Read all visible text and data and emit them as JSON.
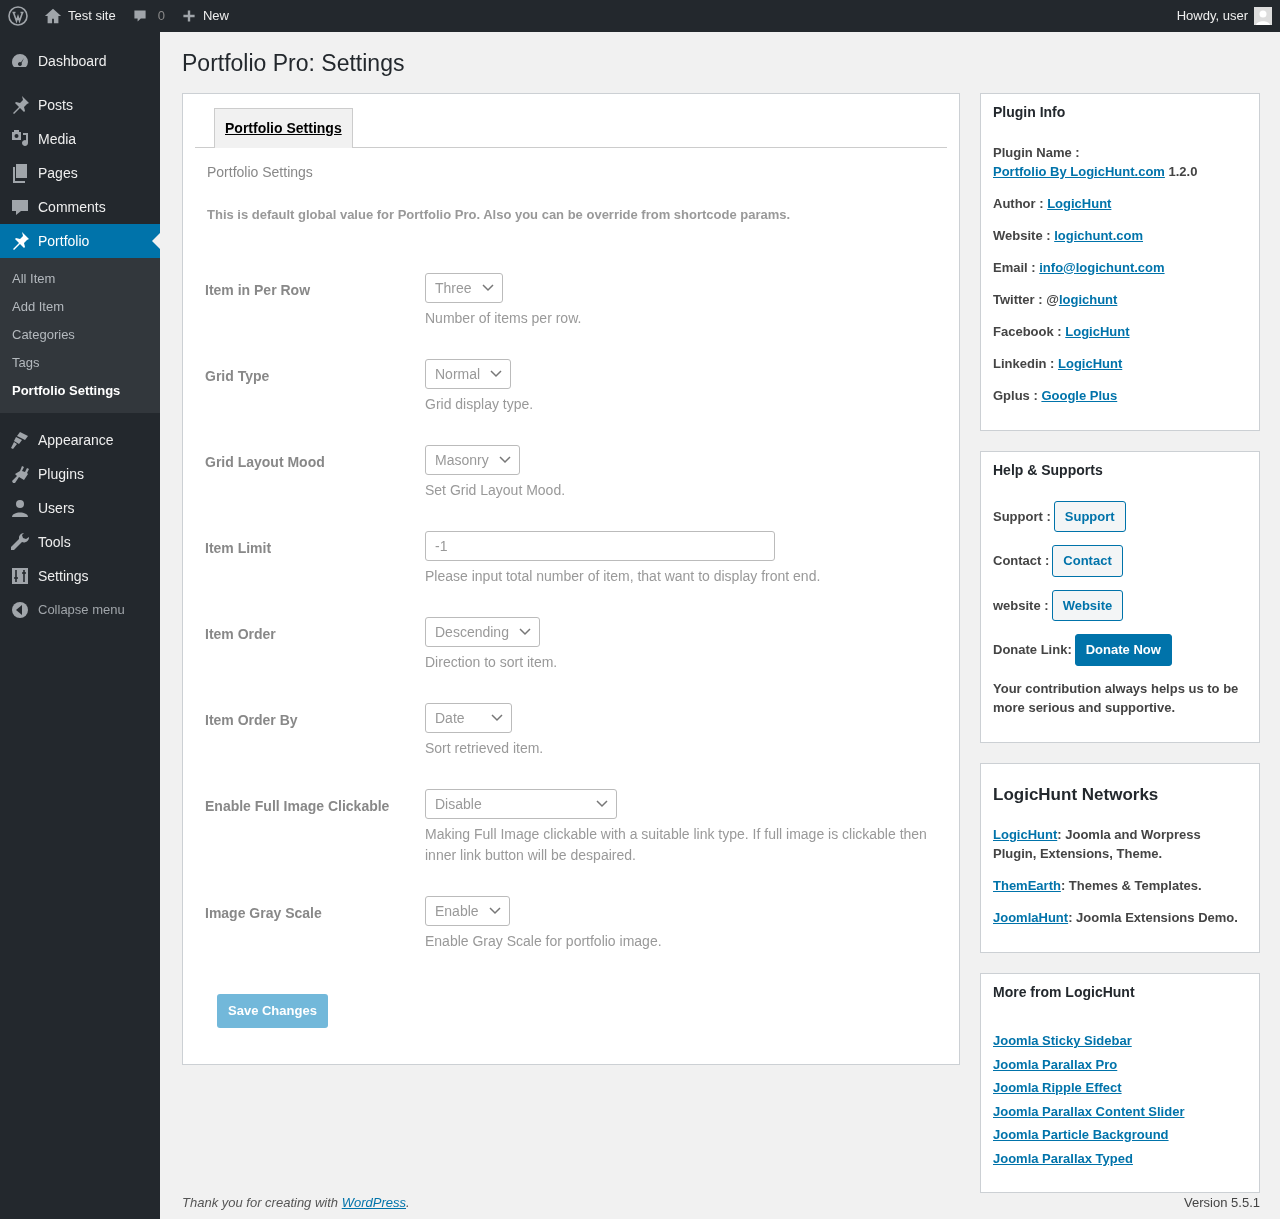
{
  "admin_bar": {
    "site_name": "Test site",
    "comments_count": "0",
    "new_label": "New",
    "greeting": "Howdy, user"
  },
  "sidebar": {
    "items": [
      {
        "label": "Dashboard",
        "selected": false
      },
      {
        "label": "Posts",
        "selected": false
      },
      {
        "label": "Media",
        "selected": false
      },
      {
        "label": "Pages",
        "selected": false
      },
      {
        "label": "Comments",
        "selected": false
      },
      {
        "label": "Portfolio",
        "selected": true,
        "children": [
          {
            "label": "All Item",
            "selected": false
          },
          {
            "label": "Add Item",
            "selected": false
          },
          {
            "label": "Categories",
            "selected": false
          },
          {
            "label": "Tags",
            "selected": false
          },
          {
            "label": "Portfolio Settings",
            "selected": true
          }
        ]
      },
      {
        "label": "Appearance",
        "selected": false
      },
      {
        "label": "Plugins",
        "selected": false
      },
      {
        "label": "Users",
        "selected": false
      },
      {
        "label": "Tools",
        "selected": false
      },
      {
        "label": "Settings",
        "selected": false
      }
    ],
    "collapse_label": "Collapse menu"
  },
  "page_title": "Portfolio Pro: Settings",
  "tabs": [
    {
      "label": "Portfolio Settings",
      "selected": true
    }
  ],
  "section_title": "Portfolio Settings",
  "intro": "This is default global value for Portfolio Pro. Also you can be override from shortcode params.",
  "fields": [
    {
      "label": "Item in Per Row",
      "kind": "select",
      "value": "Three",
      "help": "Number of items per row.",
      "disabled": true
    },
    {
      "label": "Grid Type",
      "kind": "select",
      "value": "Normal",
      "help": "Grid display type.",
      "disabled": true
    },
    {
      "label": "Grid Layout Mood",
      "kind": "select",
      "value": "Masonry",
      "help": "Set Grid Layout Mood.",
      "disabled": true
    },
    {
      "label": "Item Limit",
      "kind": "text",
      "value": "-1",
      "help": "Please input total number of item, that want to display front end.",
      "disabled": true
    },
    {
      "label": "Item Order",
      "kind": "select",
      "value": "Descending",
      "help": "Direction to sort item.",
      "disabled": true
    },
    {
      "label": "Item Order By",
      "kind": "select",
      "value": "Date",
      "help": "Sort retrieved item.",
      "disabled": true
    },
    {
      "label": "Enable Full Image Clickable",
      "kind": "select",
      "value": "Disable",
      "help": "Making Full Image clickable with a suitable link type. If full image is clickable then inner link button will be despaired.",
      "disabled": true
    },
    {
      "label": "Image Gray Scale",
      "kind": "select",
      "value": "Enable",
      "help": "Enable Gray Scale for portfolio image.",
      "disabled": true
    }
  ],
  "save_button": {
    "label": "Save Changes",
    "disabled": true
  },
  "plugin_info": {
    "title": "Plugin Info",
    "rows": [
      {
        "label": "Plugin Name : ",
        "link": "Portfolio By LogicHunt.com",
        "suffix": " 1.2.0"
      },
      {
        "label": "Author : ",
        "link": "LogicHunt"
      },
      {
        "label": "Website : ",
        "link": "logichunt.com"
      },
      {
        "label": "Email : ",
        "link": "info@logichunt.com"
      },
      {
        "label": "Twitter : @",
        "link": "logichunt"
      },
      {
        "label": "Facebook : ",
        "link": "LogicHunt"
      },
      {
        "label": "Linkedin : ",
        "link": "LogicHunt"
      },
      {
        "label": "Gplus : ",
        "link": "Google Plus"
      }
    ]
  },
  "help": {
    "title": "Help & Supports",
    "rows": [
      {
        "label": "Support :",
        "button": "Support",
        "kind": "outline"
      },
      {
        "label": "Contact :",
        "button": "Contact",
        "kind": "outline"
      },
      {
        "label": "website :",
        "button": "Website",
        "kind": "outline"
      },
      {
        "label": "Donate Link:",
        "button": "Donate Now",
        "kind": "primary"
      }
    ],
    "note": "Your contribution always helps us to be more serious and supportive."
  },
  "networks": {
    "title": "LogicHunt Networks",
    "items": [
      {
        "link": "LogicHunt",
        "text": ": Joomla and Worpress Plugin, Extensions, Theme."
      },
      {
        "link": "ThemEarth",
        "text": ": Themes & Templates."
      },
      {
        "link": "JoomlaHunt",
        "text": ": Joomla Extensions Demo."
      }
    ]
  },
  "more": {
    "title": "More from LogicHunt",
    "links": [
      "Joomla Sticky Sidebar",
      "Joomla Parallax Pro",
      "Joomla Ripple Effect",
      "Joomla Parallax Content Slider",
      "Joomla Particle Background",
      "Joomla Parallax Typed"
    ]
  },
  "footer": {
    "prefix": "Thank you for creating with ",
    "link": "WordPress",
    "suffix": ".",
    "version": "Version 5.5.1"
  }
}
